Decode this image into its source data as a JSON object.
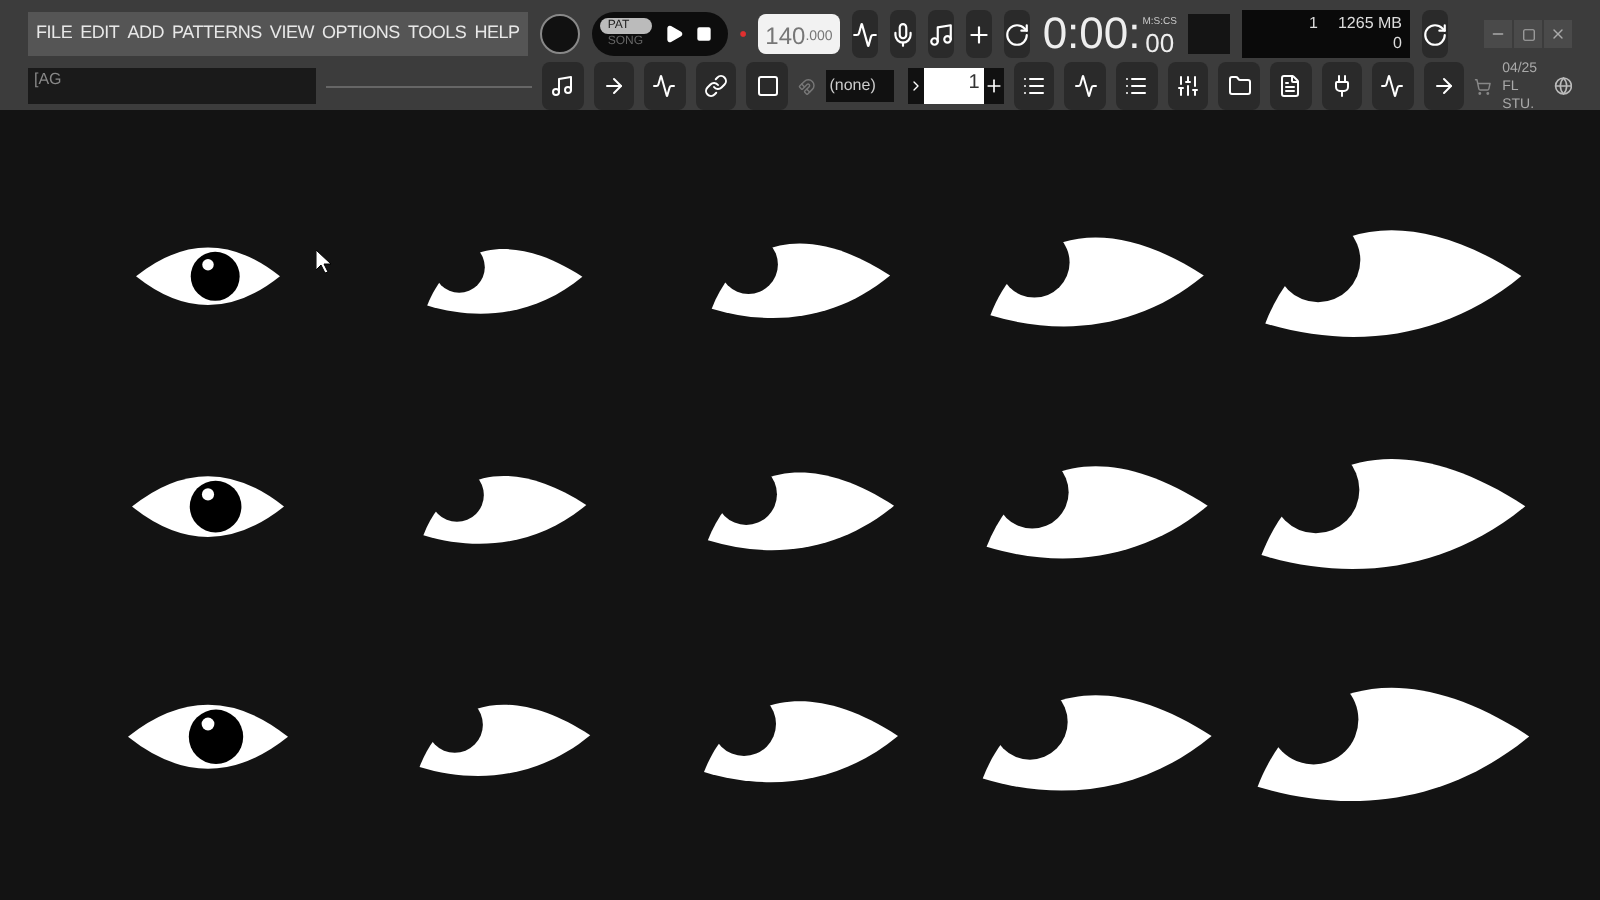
{
  "menu": [
    "FILE",
    "EDIT",
    "ADD",
    "PATTERNS",
    "VIEW",
    "OPTIONS",
    "TOOLS",
    "HELP"
  ],
  "mode": [
    {
      "label": "PAT",
      "selected": true
    },
    {
      "label": "SONG",
      "selected": false
    }
  ],
  "tempo": {
    "main": "140",
    "fraction": ".000"
  },
  "time": {
    "main": "0:00:",
    "small": "00",
    "unit": "M:S:CS"
  },
  "monitor": {
    "voices": "1",
    "memory": "1265 MB",
    "polyphony": "0"
  },
  "hint_field": {
    "value": "[AG"
  },
  "snap": {
    "value": "(none)"
  },
  "pattern": {
    "value": "1"
  },
  "news": {
    "date": "04/25",
    "title": "FL STU."
  }
}
